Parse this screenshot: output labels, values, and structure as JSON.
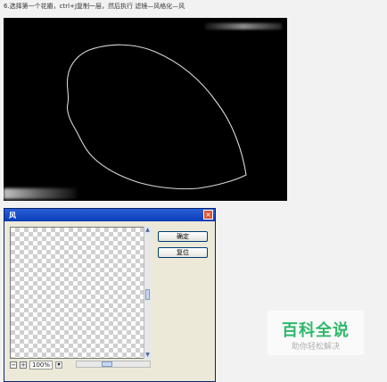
{
  "caption": "6.选择第一个花瓣，ctrl+J复制一层，然后执行 滤镜—风格化—风",
  "dialog": {
    "title": "风",
    "close_symbol": "×",
    "ok_label": "确定",
    "reset_label": "复位",
    "zoom_level": "100%",
    "zoom_out_symbol": "−",
    "zoom_in_symbol": "+"
  },
  "watermark": {
    "title": "百科全说",
    "subtitle": "助你轻松解决"
  },
  "colors": {
    "titlebar": "#0a3db8",
    "watermark_green": "#2eb86a",
    "canvas": "#000000"
  }
}
